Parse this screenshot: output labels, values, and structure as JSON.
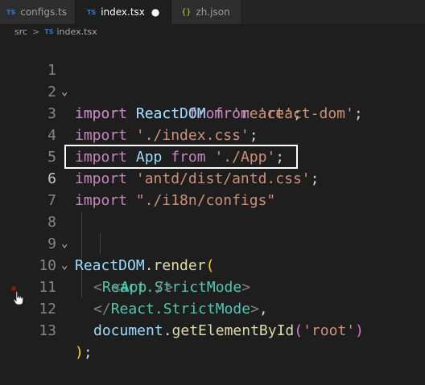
{
  "tabs": [
    {
      "icon": "TS",
      "label": "configs.ts",
      "active": false
    },
    {
      "icon": "TS",
      "label": "index.tsx",
      "active": true,
      "modified": "●"
    },
    {
      "icon": "{}",
      "label": "zh.json",
      "active": false
    }
  ],
  "breadcrumb": {
    "folder": "src",
    "separator": ">",
    "icon": "TS",
    "file": "index.tsx"
  },
  "gutter": {
    "fold_open": "⌄"
  },
  "code": {
    "l1": {
      "n": "1",
      "t1": "import",
      "t2": " ",
      "t3": "React",
      "t4": " ",
      "t5": "from",
      "t6": " ",
      "t7": "'react'",
      "t8": ";"
    },
    "l2": {
      "n": "2",
      "t1": "import",
      "t2": " ",
      "t3": "ReactDOM",
      "t4": " ",
      "t5": "from",
      "t6": " ",
      "t7": "'react-dom'",
      "t8": ";"
    },
    "l3": {
      "n": "3",
      "t1": "import",
      "t2": " ",
      "t3": "'./index.css'",
      "t4": ";"
    },
    "l4": {
      "n": "4",
      "t1": "import",
      "t2": " ",
      "t3": "App",
      "t4": " ",
      "t5": "from",
      "t6": " ",
      "t7": "'./App'",
      "t8": ";"
    },
    "l5": {
      "n": "5",
      "t1": "import",
      "t2": " ",
      "t3": "'antd/dist/antd.css'",
      "t4": ";"
    },
    "l6": {
      "n": "6",
      "t1": "import",
      "t2": " ",
      "t3": "\"./i18n/configs\""
    },
    "l7": {
      "n": "7"
    },
    "l8": {
      "n": "8",
      "t1": "ReactDOM",
      "t2": ".",
      "t3": "render",
      "t4": "("
    },
    "l9": {
      "n": "9",
      "t1": "<",
      "t2": "React.StrictMode",
      "t3": ">"
    },
    "l10": {
      "n": "10",
      "t1": "<",
      "t2": "App",
      "t3": " />"
    },
    "l11": {
      "n": "11",
      "t1": "</",
      "t2": "React.StrictMode",
      "t3": ">",
      "t4": ","
    },
    "l12": {
      "n": "12",
      "t1": "document",
      "t2": ".",
      "t3": "getElementById",
      "t4": "(",
      "t5": "'root'",
      "t6": ")"
    },
    "l13": {
      "n": "13",
      "t1": ")",
      "t2": ";"
    }
  },
  "colors": {
    "background": "#1e1e1e",
    "keyword": "#c586c0",
    "string": "#ce9178",
    "variable": "#9cdcfe",
    "function": "#dcdcaa",
    "tag": "#4ec9b0",
    "highlight_box": "#ffffff",
    "breakpoint": "#e51400"
  }
}
